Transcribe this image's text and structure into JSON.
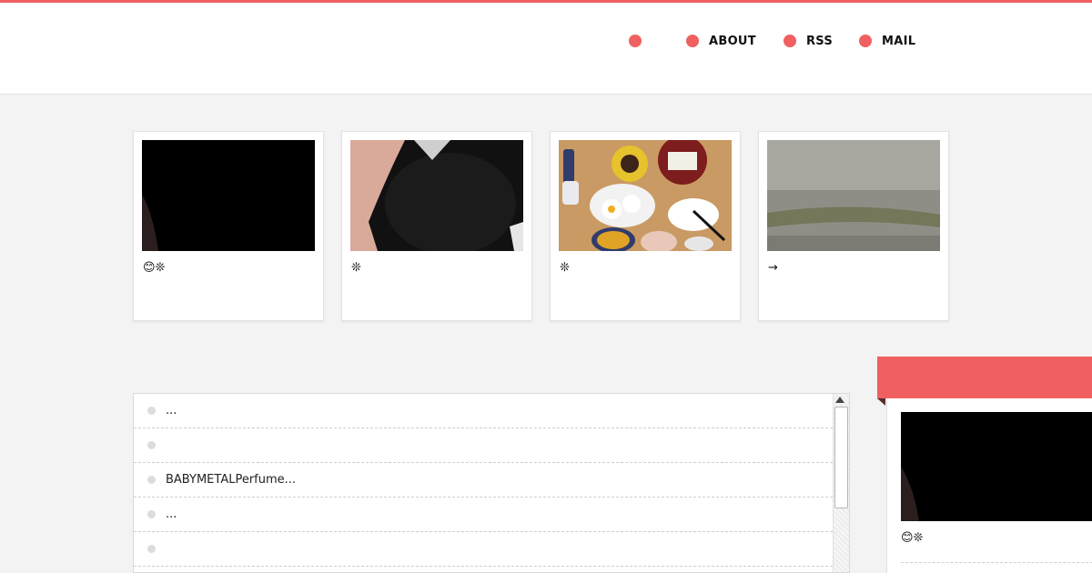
{
  "theme": {
    "accent": "#f06060",
    "background": "#f3f3f3"
  },
  "nav": {
    "items": [
      {
        "label": ""
      },
      {
        "label": "ABOUT"
      },
      {
        "label": "RSS"
      },
      {
        "label": "MAIL"
      }
    ]
  },
  "cards": [
    {
      "caption": "😊❊"
    },
    {
      "caption": "❊"
    },
    {
      "caption": "❊"
    },
    {
      "caption": "→"
    }
  ],
  "list": {
    "items": [
      {
        "text": "..."
      },
      {
        "text": ""
      },
      {
        "text": "BABYMETALPerfume..."
      },
      {
        "text": "..."
      },
      {
        "text": ""
      }
    ]
  },
  "sidebar": {
    "card": {
      "caption": "😊❊"
    }
  }
}
